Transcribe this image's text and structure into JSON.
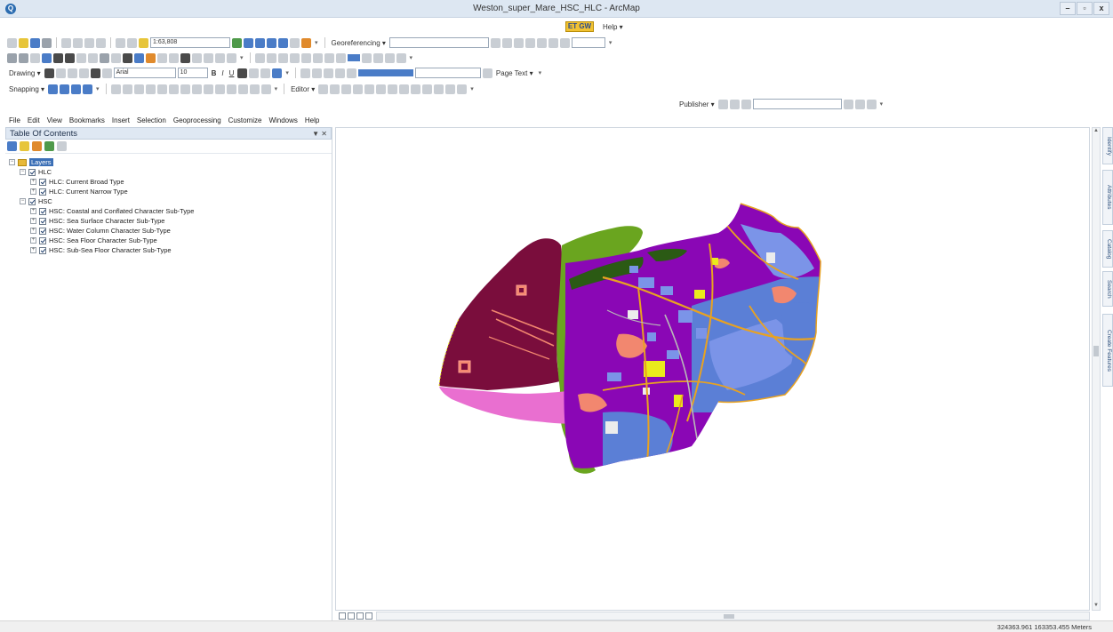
{
  "window": {
    "title": "Weston_super_Mare_HSC_HLC - ArcMap",
    "buttons": [
      "–",
      "▫",
      "x"
    ]
  },
  "toolbar": {
    "scale": "1:63,808",
    "georeferencing_label": "Georeferencing ▾",
    "help_label": "Help ▾",
    "gw_badge": "ET GW",
    "drawing_label": "Drawing ▾",
    "font_name": "Arial",
    "font_size": "10",
    "bold": "B",
    "italic": "I",
    "underline": "U",
    "page_text_label": "Page Text ▾",
    "snapping_label": "Snapping ▾",
    "editor_label": "Editor ▾",
    "publisher_label": "Publisher ▾"
  },
  "menu": [
    "File",
    "Edit",
    "View",
    "Bookmarks",
    "Insert",
    "Selection",
    "Geoprocessing",
    "Customize",
    "Windows",
    "Help"
  ],
  "toc": {
    "title": "Table Of Contents",
    "pin": "▼ ✕",
    "root": "Layers",
    "groups": [
      {
        "name": "HLC",
        "layers": [
          "HLC: Current Broad Type",
          "HLC: Current Narrow Type"
        ]
      },
      {
        "name": "HSC",
        "layers": [
          "HSC: Coastal and Conflated Character Sub-Type",
          "HSC: Sea Surface Character Sub-Type",
          "HSC: Water Column Character Sub-Type",
          "HSC: Sea Floor Character Sub-Type",
          "HSC: Sub-Sea Floor Character Sub-Type"
        ]
      }
    ]
  },
  "dock_tabs": [
    "Identify",
    "Attributes",
    "Catalog",
    "Search",
    "Create Features"
  ],
  "status": {
    "coordinates": "324363.961  163353.455 Meters"
  },
  "map": {
    "colors": {
      "sea_maroon": "#7a0d3c",
      "intertidal_green": "#6aa51f",
      "beach_pink": "#e96fd0",
      "urban_purple": "#8a07b5",
      "farmland_blue": "#5b7fd6",
      "light_blue": "#7b94e8",
      "salmon": "#f2876f",
      "orange_roads": "#e8a221",
      "yellow": "#eaea1c",
      "dark_green": "#2b5a14",
      "white": "#ececec"
    }
  }
}
